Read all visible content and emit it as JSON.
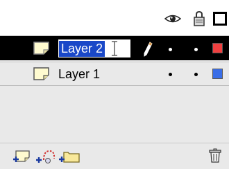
{
  "header": {
    "columns": [
      "show-hide-all",
      "lock-all",
      "outline-all"
    ]
  },
  "layers": [
    {
      "name": "Layer 2",
      "selected": true,
      "editing": true,
      "visibility_state": "dot",
      "lock_state": "dot",
      "outline_color": "#f04040"
    },
    {
      "name": "Layer 1",
      "selected": false,
      "editing": false,
      "visibility_state": "dot",
      "lock_state": "dot",
      "outline_color": "#3a6ee8"
    }
  ],
  "footer": {
    "buttons": [
      "insert-layer",
      "add-motion-guide",
      "insert-layer-folder",
      "delete-layer"
    ]
  },
  "colors": {
    "selection_bg": "#000000",
    "text_highlight": "#1a48c8",
    "panel_bg": "#e9e9e9"
  }
}
